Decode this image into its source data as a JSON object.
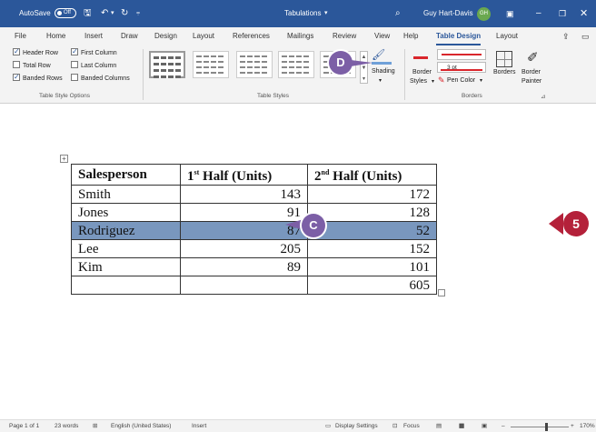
{
  "titlebar": {
    "autosave_label": "AutoSave",
    "autosave_state": "Off",
    "doc_title": "Tabulations",
    "user_name": "Guy Hart-Davis",
    "user_initials": "GH"
  },
  "tabs": [
    {
      "label": "File"
    },
    {
      "label": "Home"
    },
    {
      "label": "Insert"
    },
    {
      "label": "Draw"
    },
    {
      "label": "Design"
    },
    {
      "label": "Layout"
    },
    {
      "label": "References"
    },
    {
      "label": "Mailings"
    },
    {
      "label": "Review"
    },
    {
      "label": "View"
    },
    {
      "label": "Help"
    },
    {
      "label": "Table Design",
      "active": true
    },
    {
      "label": "Layout"
    }
  ],
  "ribbon": {
    "options": {
      "header_row": "Header Row",
      "first_column": "First Column",
      "total_row": "Total Row",
      "last_column": "Last Column",
      "banded_rows": "Banded Rows",
      "banded_columns": "Banded Columns",
      "group_label": "Table Style Options"
    },
    "styles": {
      "group_label": "Table Styles",
      "shading": "Shading"
    },
    "borders": {
      "border_styles_1": "Border",
      "border_styles_2": "Styles",
      "pen_weight": "3 pt",
      "pen_color": "Pen Color",
      "borders_btn": "Borders",
      "painter_1": "Border",
      "painter_2": "Painter",
      "group_label": "Borders"
    }
  },
  "callouts": {
    "c": "C",
    "d": "D",
    "five": "5"
  },
  "table": {
    "headers": [
      "Salesperson",
      "1",
      "st",
      " Half (Units)",
      "2",
      "nd",
      " Half (Units)"
    ],
    "rows": [
      [
        "Smith",
        "143",
        "172"
      ],
      [
        "Jones",
        "91",
        "128"
      ],
      [
        "Rodriguez",
        "87",
        "52"
      ],
      [
        "Lee",
        "205",
        "152"
      ],
      [
        "Kim",
        "89",
        "101"
      ],
      [
        "",
        "",
        "605"
      ]
    ]
  },
  "status": {
    "page": "Page 1 of 1",
    "words": "23 words",
    "language": "English (United States)",
    "mode": "Insert",
    "display_settings": "Display Settings",
    "focus": "Focus",
    "zoom": "170%"
  },
  "colors": {
    "titlebar": "#2b579a",
    "callout": "#7c5fa6",
    "arrow": "#b4213a",
    "selected_row": "#7997be"
  }
}
